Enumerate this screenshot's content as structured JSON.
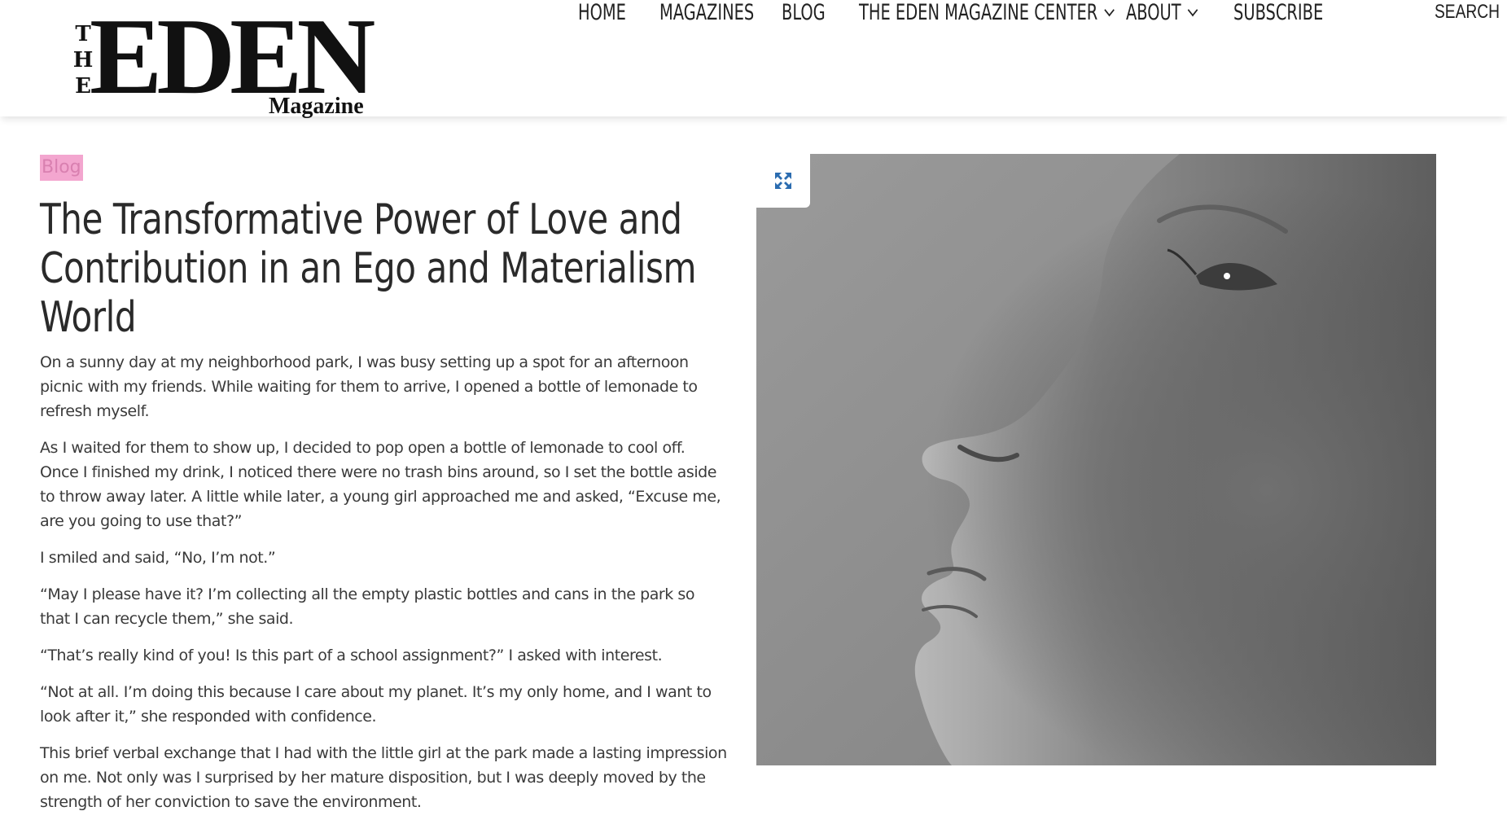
{
  "brand": {
    "logo_the": [
      "T",
      "H",
      "E"
    ],
    "logo_main": "EDEN",
    "logo_sub": "Magazine"
  },
  "nav": {
    "items": [
      {
        "label": "HOME",
        "has_dropdown": false
      },
      {
        "label": "MAGAZINES",
        "has_dropdown": false
      },
      {
        "label": "BLOG",
        "has_dropdown": false
      },
      {
        "label": "THE EDEN MAGAZINE CENTER",
        "has_dropdown": true
      },
      {
        "label": "ABOUT",
        "has_dropdown": true
      },
      {
        "label": "SUBSCRIBE",
        "has_dropdown": false
      }
    ],
    "search_label": "SEARCH"
  },
  "article": {
    "category": "Blog",
    "title": "The Transformative Power of Love and Contribution in an Ego and Materialism World",
    "paragraphs": [
      "On a sunny day at my neighborhood park, I was busy setting up a spot for an afternoon picnic with my friends. While waiting for them to arrive, I opened a bottle of lemonade to refresh myself.",
      "As I waited for them to show up, I decided to pop open a bottle of lemonade to cool off. Once I finished my drink, I noticed there were no trash bins around, so I set the bottle aside to throw away later. A little while later, a young girl approached me and asked, “Excuse me, are you going to use that?”",
      "I smiled and said, “No, I’m not.”",
      "“May I please have it? I’m collecting all the empty plastic bottles and cans in the park so that I can recycle them,” she said.",
      "“That’s really kind of you! Is this part of a school assignment?” I asked with interest.",
      "“Not at all. I’m doing this because I care about my planet. It’s my only home, and I want to look after it,” she responded with confidence.",
      "This brief verbal exchange that I had with the little girl at the park made a lasting impression on me. Not only was I surprised by her mature disposition, but I was deeply moved by the strength of her conviction to save the environment."
    ]
  },
  "hero": {
    "icon": "expand-icon"
  },
  "colors": {
    "category_bg": "#f3a6cf",
    "category_text": "#d980b0",
    "expand_icon": "#2b6cb0",
    "text": "#3a3a3a"
  }
}
